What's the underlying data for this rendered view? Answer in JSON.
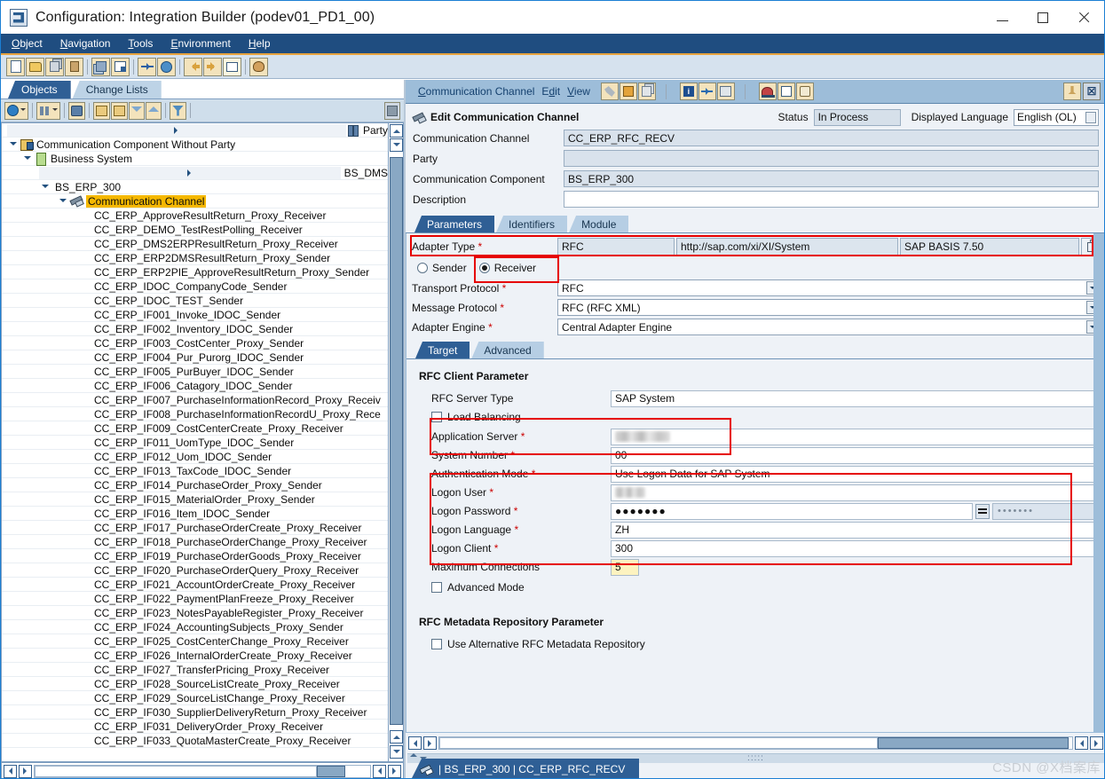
{
  "window": {
    "title": "Configuration: Integration Builder (podev01_PD1_00)",
    "minimize": "–",
    "maximize": "□",
    "close": "✕"
  },
  "menubar": {
    "items": [
      {
        "label": "Object",
        "accel": "O"
      },
      {
        "label": "Navigation",
        "accel": "N"
      },
      {
        "label": "Tools",
        "accel": "T"
      },
      {
        "label": "Environment",
        "accel": "E"
      },
      {
        "label": "Help",
        "accel": "H"
      }
    ]
  },
  "main_toolbar": {
    "buttons": [
      {
        "name": "new-icon",
        "title": "New"
      },
      {
        "name": "open-folder-icon",
        "title": "Open"
      },
      {
        "name": "copy-icon",
        "title": "Copy"
      },
      {
        "name": "delete-icon",
        "title": "Delete"
      },
      {
        "name": "stack-icon",
        "title": "Change Lists"
      },
      {
        "name": "list-icon",
        "title": "Activate"
      },
      {
        "name": "connect-icon",
        "title": "Where Used"
      },
      {
        "name": "globe-icon",
        "title": "Help"
      },
      {
        "name": "back-icon",
        "title": "Back"
      },
      {
        "name": "forward-icon",
        "title": "Forward"
      },
      {
        "name": "grid-icon",
        "title": "Overview"
      },
      {
        "name": "palette-icon",
        "title": "Settings"
      }
    ]
  },
  "left_panel": {
    "tabs": [
      {
        "label": "Objects",
        "active": true
      },
      {
        "label": "Change Lists",
        "active": false
      }
    ],
    "toolbar": [
      {
        "name": "refresh-icon"
      },
      {
        "name": "find-objects-icon"
      },
      {
        "name": "binoculars-icon"
      },
      {
        "name": "expand-tree-icon"
      },
      {
        "name": "collapse-tree-icon"
      },
      {
        "name": "move-down-icon"
      },
      {
        "name": "move-up-icon"
      },
      {
        "name": "filter-icon"
      },
      {
        "name": "stop-icon"
      }
    ],
    "tree": [
      {
        "label": "Party",
        "indent": 0,
        "twist": "right",
        "icon": "party-icon",
        "selected": false
      },
      {
        "label": "Communication Component Without Party",
        "indent": 1,
        "twist": "down",
        "icon": "component-icon",
        "selected": false
      },
      {
        "label": "Business System",
        "indent": 2,
        "twist": "down",
        "icon": "business-system-icon",
        "selected": false
      },
      {
        "label": "BS_DMS",
        "indent": 3,
        "twist": "right",
        "icon": "",
        "selected": false
      },
      {
        "label": "BS_ERP_300",
        "indent": 3,
        "twist": "down",
        "icon": "",
        "selected": false
      },
      {
        "label": "Communication Channel",
        "indent": 4,
        "twist": "down",
        "icon": "channel-icon",
        "selected": true
      }
    ],
    "channels": [
      "CC_ERP_ApproveResultReturn_Proxy_Receiver",
      "CC_ERP_DEMO_TestRestPolling_Receiver",
      "CC_ERP_DMS2ERPResultReturn_Proxy_Receiver",
      "CC_ERP_ERP2DMSResultReturn_Proxy_Sender",
      "CC_ERP_ERP2PIE_ApproveResultReturn_Proxy_Sender",
      "CC_ERP_IDOC_CompanyCode_Sender",
      "CC_ERP_IDOC_TEST_Sender",
      "CC_ERP_IF001_Invoke_IDOC_Sender",
      "CC_ERP_IF002_Inventory_IDOC_Sender",
      "CC_ERP_IF003_CostCenter_Proxy_Sender",
      "CC_ERP_IF004_Pur_Purorg_IDOC_Sender",
      "CC_ERP_IF005_PurBuyer_IDOC_Sender",
      "CC_ERP_IF006_Catagory_IDOC_Sender",
      "CC_ERP_IF007_PurchaseInformationRecord_Proxy_Receiv",
      "CC_ERP_IF008_PurchaseInformationRecordU_Proxy_Rece",
      "CC_ERP_IF009_CostCenterCreate_Proxy_Receiver",
      "CC_ERP_IF011_UomType_IDOC_Sender",
      "CC_ERP_IF012_Uom_IDOC_Sender",
      "CC_ERP_IF013_TaxCode_IDOC_Sender",
      "CC_ERP_IF014_PurchaseOrder_Proxy_Sender",
      "CC_ERP_IF015_MaterialOrder_Proxy_Sender",
      "CC_ERP_IF016_Item_IDOC_Sender",
      "CC_ERP_IF017_PurchaseOrderCreate_Proxy_Receiver",
      "CC_ERP_IF018_PurchaseOrderChange_Proxy_Receiver",
      "CC_ERP_IF019_PurchaseOrderGoods_Proxy_Receiver",
      "CC_ERP_IF020_PurchaseOrderQuery_Proxy_Receiver",
      "CC_ERP_IF021_AccountOrderCreate_Proxy_Receiver",
      "CC_ERP_IF022_PaymentPlanFreeze_Proxy_Receiver",
      "CC_ERP_IF023_NotesPayableRegister_Proxy_Receiver",
      "CC_ERP_IF024_AccountingSubjects_Proxy_Sender",
      "CC_ERP_IF025_CostCenterChange_Proxy_Receiver",
      "CC_ERP_IF026_InternalOrderCreate_Proxy_Receiver",
      "CC_ERP_IF027_TransferPricing_Proxy_Receiver",
      "CC_ERP_IF028_SourceListCreate_Proxy_Receiver",
      "CC_ERP_IF029_SourceListChange_Proxy_Receiver",
      "CC_ERP_IF030_SupplierDeliveryReturn_Proxy_Receiver",
      "CC_ERP_IF031_DeliveryOrder_Proxy_Receiver",
      "CC_ERP_IF033_QuotaMasterCreate_Proxy_Receiver"
    ]
  },
  "right_panel": {
    "menu": [
      {
        "label": "Communication Channel",
        "accel": "C"
      },
      {
        "label": "Edit",
        "accel": "d"
      },
      {
        "label": "View",
        "accel": "V"
      }
    ],
    "toolbar": [
      {
        "name": "wrench-icon"
      },
      {
        "name": "save-icon"
      },
      {
        "name": "copy-pages-icon"
      },
      {
        "name": "info-icon"
      },
      {
        "name": "where-used-icon"
      },
      {
        "name": "compare-icon"
      },
      {
        "name": "cache-icon"
      },
      {
        "name": "documentation-icon"
      },
      {
        "name": "history-icon"
      }
    ],
    "pin_icon": "pin-icon",
    "close_label": "☒",
    "header": {
      "title": "Edit Communication Channel",
      "status_label": "Status",
      "status_value": "In Process",
      "language_label": "Displayed Language",
      "language_value": "English (OL)"
    },
    "fields": [
      {
        "label": "Communication Channel",
        "value": "CC_ERP_RFC_RECV",
        "name": "communication-channel-field"
      },
      {
        "label": "Party",
        "value": "",
        "name": "party-field"
      },
      {
        "label": "Communication Component",
        "value": "BS_ERP_300",
        "name": "communication-component-field"
      },
      {
        "label": "Description",
        "value": "",
        "name": "description-field"
      }
    ],
    "param_tabs": [
      {
        "label": "Parameters",
        "active": true
      },
      {
        "label": "Identifiers",
        "active": false
      },
      {
        "label": "Module",
        "active": false
      }
    ],
    "adapter": {
      "label": "Adapter Type",
      "required": "*",
      "type": "RFC",
      "namespace": "http://sap.com/xi/XI/System",
      "software_component": "SAP BASIS 7.50",
      "copy_icon": "copy-icon"
    },
    "direction": {
      "sender_label": "Sender",
      "receiver_label": "Receiver",
      "selected": "Receiver"
    },
    "protocol_rows": [
      {
        "label": "Transport Protocol",
        "required": "*",
        "value": "RFC",
        "name": "transport-protocol-select"
      },
      {
        "label": "Message Protocol",
        "required": "*",
        "value": "RFC (RFC XML)",
        "name": "message-protocol-select"
      },
      {
        "label": "Adapter Engine",
        "required": "*",
        "value": "Central Adapter Engine",
        "name": "adapter-engine-select"
      }
    ],
    "inner_tabs": [
      {
        "label": "Target",
        "active": true
      },
      {
        "label": "Advanced",
        "active": false
      }
    ],
    "rfc_client": {
      "section_title": "RFC Client Parameter",
      "server_type_label": "RFC Server Type",
      "server_type_value": "SAP System",
      "load_balancing_label": "Load Balancing",
      "load_balancing_checked": false,
      "application_server_label": "Application Server",
      "application_server_value": "",
      "system_number_label": "System Number",
      "system_number_value": "00",
      "auth_mode_label": "Authentication Mode",
      "auth_mode_value": "Use Logon Data for SAP System",
      "logon_user_label": "Logon User",
      "logon_user_value": "",
      "logon_password_label": "Logon Password",
      "logon_password_value": "●●●●●●●",
      "logon_password_confirm": "•••••••",
      "logon_language_label": "Logon Language",
      "logon_language_value": "ZH",
      "logon_client_label": "Logon Client",
      "logon_client_value": "300",
      "max_connections_label": "Maximum Connections",
      "max_connections_value": "5",
      "advanced_mode_label": "Advanced Mode",
      "advanced_mode_checked": false,
      "required_marker": "*"
    },
    "rfc_metadata": {
      "section_title": "RFC Metadata Repository Parameter",
      "use_alt_label": "Use Alternative RFC Metadata Repository",
      "use_alt_checked": false
    },
    "document_tab": "| BS_ERP_300 | CC_ERP_RFC_RECV"
  },
  "watermark": "CSDN @X档案库",
  "colors": {
    "accent_blue": "#2f5f95",
    "menubar_blue": "#1f4d80",
    "orange_rule": "#e8a33d",
    "highlight_yellow": "#f5b800",
    "required_red": "#cc0000",
    "annotation_red": "#e60000"
  }
}
